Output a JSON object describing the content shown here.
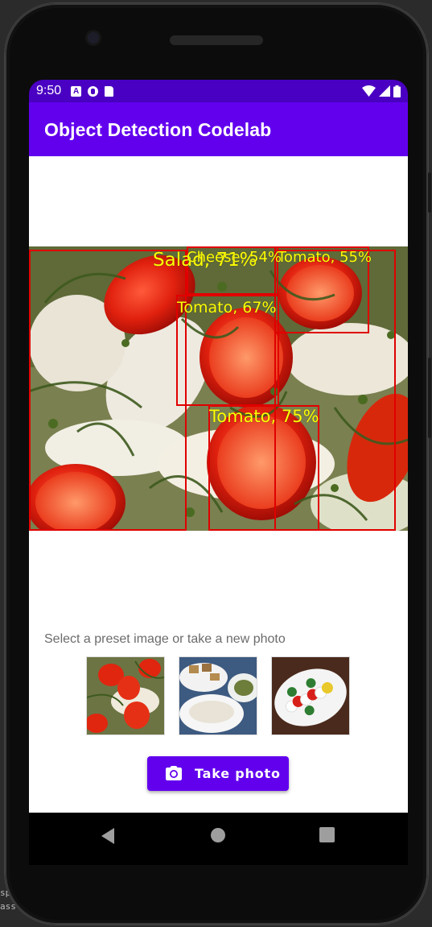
{
  "status_bar": {
    "time": "9:50",
    "left_icons": [
      "a-notification-icon",
      "circle-notification-icon",
      "sd-card-icon"
    ],
    "right_icons": [
      "wifi-icon",
      "cell-signal-icon",
      "battery-icon"
    ]
  },
  "app_bar": {
    "title": "Object Detection Codelab"
  },
  "detections": [
    {
      "label": "Salad, 71%"
    },
    {
      "label": "Cheese, 54%"
    },
    {
      "label": "Tomato, 55%"
    },
    {
      "label": "Tomato, 67%"
    },
    {
      "label": "Tomato, 75%"
    }
  ],
  "prompt": "Select a preset image or take a new photo",
  "presets": [
    {
      "name": "tomato-salad-preset"
    },
    {
      "name": "mixed-food-preset"
    },
    {
      "name": "caprese-salad-preset"
    }
  ],
  "take_photo": {
    "label": "Take photo",
    "icon": "camera-icon"
  },
  "colors": {
    "status_bar": "#4a00c2",
    "primary": "#6200ee",
    "box": "#e00000",
    "box_label": "#ffff00"
  },
  "nav": {
    "back": "back-icon",
    "home": "home-icon",
    "recents": "recents-icon"
  }
}
